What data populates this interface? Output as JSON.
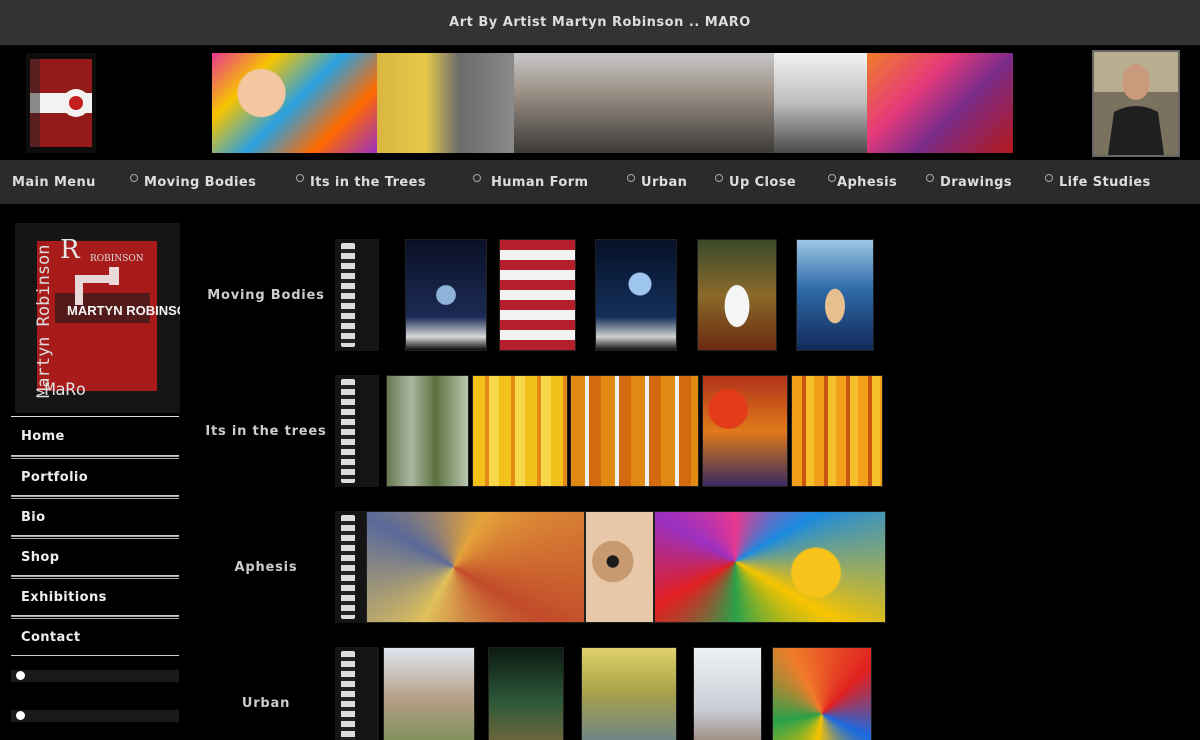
{
  "site_title": "Art By Artist Martyn Robinson .. MARO",
  "nav": {
    "items": [
      {
        "label": "Main Menu",
        "dot": false
      },
      {
        "label": "Moving Bodies",
        "dot": true
      },
      {
        "label": "Its in the Trees",
        "dot": true
      },
      {
        "label": "Human Form",
        "dot": true
      },
      {
        "label": "Urban",
        "dot": true
      },
      {
        "label": "Up Close",
        "dot": true
      },
      {
        "label": "Aphesis",
        "dot": true
      },
      {
        "label": "Drawings",
        "dot": true
      },
      {
        "label": "Life Studies",
        "dot": true
      }
    ]
  },
  "side_logo": {
    "vertical_text": "Martyn Robinson",
    "top_right_text": "ROBINSON",
    "big_letter": "R",
    "name_text": "MARTYN ROBINSON",
    "bottom_text": "MaRo"
  },
  "side_menu": {
    "items": [
      "Home",
      "Portfolio",
      "Bio",
      "Shop",
      "Exhibitions",
      "Contact"
    ]
  },
  "gallery": {
    "rows": [
      {
        "label": "Moving Bodies"
      },
      {
        "label": "Its in the trees"
      },
      {
        "label": "Aphesis"
      },
      {
        "label": "Urban"
      }
    ]
  },
  "colors": {
    "topbar": "#333333",
    "navbar": "#2b2b2b",
    "background": "#000000",
    "text": "#dddddd",
    "accent_red": "#c41e1e"
  }
}
